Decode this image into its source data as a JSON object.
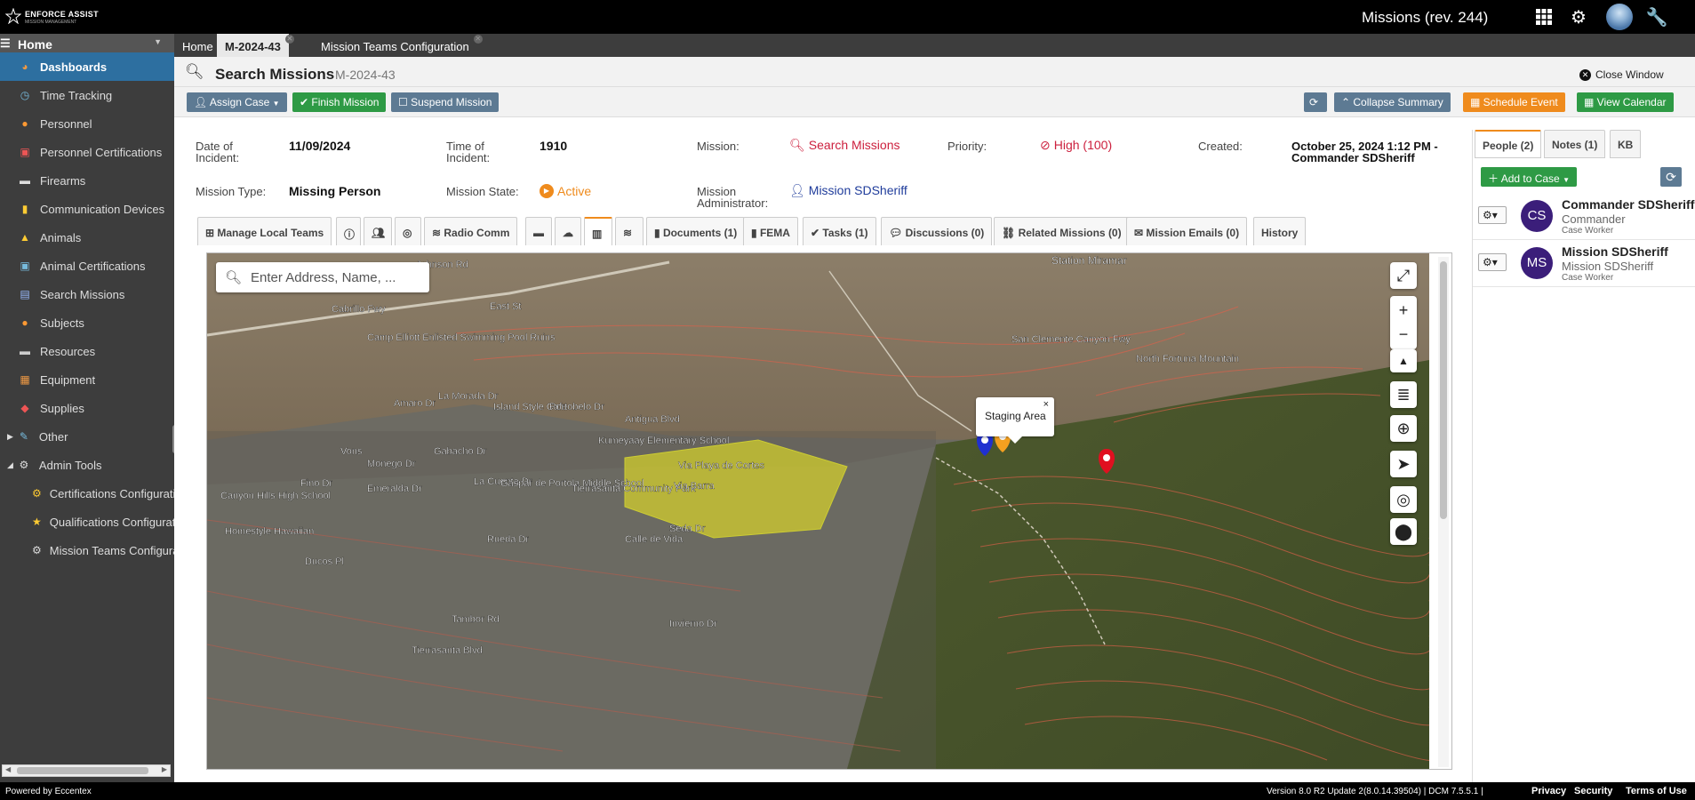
{
  "topbar": {
    "logo_name": "ENFORCE ASSIST",
    "logo_tag": "MISSION MANAGEMENT",
    "title": "Missions (rev. 244)",
    "icons": [
      "apps-grid-icon",
      "gear-icon",
      "user-avatar",
      "wrench-icon"
    ]
  },
  "sidebar": {
    "home": "Home",
    "items": [
      {
        "label": "Dashboards",
        "icon": "dashboard-icon",
        "active": true
      },
      {
        "label": "Time Tracking",
        "icon": "clock-icon"
      },
      {
        "label": "Personnel",
        "icon": "person-icon"
      },
      {
        "label": "Personnel Certifications",
        "icon": "certificate-icon"
      },
      {
        "label": "Firearms",
        "icon": "firearm-icon"
      },
      {
        "label": "Communication Devices",
        "icon": "radio-icon"
      },
      {
        "label": "Animals",
        "icon": "animal-icon"
      },
      {
        "label": "Animal Certifications",
        "icon": "certificate-icon"
      },
      {
        "label": "Search Missions",
        "icon": "document-icon"
      },
      {
        "label": "Subjects",
        "icon": "person-icon"
      },
      {
        "label": "Resources",
        "icon": "truck-icon"
      },
      {
        "label": "Equipment",
        "icon": "equipment-icon"
      },
      {
        "label": "Supplies",
        "icon": "supplies-icon"
      },
      {
        "label": "Other",
        "icon": "wrench-icon"
      },
      {
        "label": "Admin Tools",
        "icon": "gear-icon"
      },
      {
        "label": "Certifications Configuratio",
        "icon": "gear-icon",
        "sub": true
      },
      {
        "label": "Qualifications Configuratio",
        "icon": "medal-icon",
        "sub": true
      },
      {
        "label": "Mission Teams Configurat",
        "icon": "gear-icon",
        "sub": true
      }
    ]
  },
  "tabs": [
    {
      "label": "Home"
    },
    {
      "label": "M-2024-43",
      "active": true
    },
    {
      "label": "Mission Teams Configuration"
    }
  ],
  "header": {
    "title": "Search Missions",
    "subtitle": "M-2024-43",
    "close": "Close Window"
  },
  "actions": {
    "assign_case": "Assign Case",
    "finish": "Finish Mission",
    "suspend": "Suspend Mission",
    "collapse": "Collapse Summary",
    "schedule": "Schedule Event",
    "calendar": "View Calendar"
  },
  "summary": {
    "date_label": "Date of Incident:",
    "date_value": "11/09/2024",
    "time_label": "Time of Incident:",
    "time_value": "1910",
    "mission_label": "Mission:",
    "mission_value": "Search Missions",
    "priority_label": "Priority:",
    "priority_value": "High (100)",
    "created_label": "Created:",
    "created_value": "October 25, 2024 1:12 PM - Commander SDSheriff",
    "type_label": "Mission Type:",
    "type_value": "Missing Person",
    "state_label": "Mission State:",
    "state_value": "Active",
    "admin_label": "Mission Administrator:",
    "admin_value": "Mission SDSheriff"
  },
  "subtabs": [
    {
      "label": "Manage Local Teams",
      "icon": "org-chart-icon"
    },
    {
      "label": "",
      "icon": "info-icon"
    },
    {
      "label": "",
      "icon": "group-icon"
    },
    {
      "label": "",
      "icon": "binoculars-icon"
    },
    {
      "label": "Radio Comm",
      "icon": "wifi-icon"
    },
    {
      "label": "",
      "icon": "truck-icon"
    },
    {
      "label": "",
      "icon": "cloud-icon"
    },
    {
      "label": "",
      "icon": "map-icon",
      "active": true
    },
    {
      "label": "",
      "icon": "signal-icon"
    },
    {
      "label": "Documents (1)",
      "icon": "book-icon"
    },
    {
      "label": "FEMA",
      "icon": "book-icon"
    },
    {
      "label": "Tasks (1)",
      "icon": "check-circle-icon"
    },
    {
      "label": "Discussions (0)",
      "icon": "comment-icon"
    },
    {
      "label": "Related Missions (0)",
      "icon": "link-icon"
    },
    {
      "label": "Mission Emails (0)",
      "icon": "envelope-icon"
    },
    {
      "label": "History",
      "icon": ""
    }
  ],
  "map": {
    "search_placeholder": "Enter Address, Name, ...",
    "popup": "Staging Area",
    "labels": [
      "Station Miramar",
      "Johnson Rd",
      "Cabrillo Fwy",
      "East St",
      "Camp Elliott Enlisted Swimming Pool Ruins",
      "San Clemente Canyon Fwy",
      "North Fortuna Mountain",
      "La Morada Dr",
      "Island Style Cafe",
      "Portobelo Dr",
      "Antigua Blvd",
      "Amaro Dr",
      "Kumeyaay Elementary School",
      "Via Playa de Cortes",
      "Gabacho Dr",
      "Monego Dr",
      "Vons",
      "La Cuenta Dr",
      "Gaspar de Portola Middle School",
      "Tierrasanta Community Park",
      "Canyon Hills High School",
      "Emeralda Dr",
      "Fino Dr",
      "Homestyle Hawaiian",
      "Ducos Pl",
      "Rueda Dr",
      "Seda Dr",
      "Calle de Vida",
      "Tambor Rd",
      "Tierrasanta Blvd",
      "Invierno Dr",
      "Via Barra"
    ]
  },
  "people_panel": {
    "tabs": [
      "People (2)",
      "Notes (1)",
      "KB"
    ],
    "add": "Add to Case",
    "people": [
      {
        "initials": "CS",
        "name": "Commander SDSheriff",
        "role": "Commander",
        "type": "Case Worker"
      },
      {
        "initials": "MS",
        "name": "Mission SDSheriff",
        "role": "Mission SDSheriff",
        "type": "Case Worker"
      }
    ]
  },
  "footer": {
    "powered": "Powered by Eccentex",
    "version": "Version  8.0 R2 Update 2(8.0.14.39504) | DCM 7.5.5.1 |",
    "privacy": "Privacy",
    "security": "Security",
    "terms": "Terms of Use"
  },
  "colors": {
    "accent": "#2d6fa0",
    "green": "#2e9a45",
    "orange": "#ef8b1d",
    "priority": "#cc1f3d",
    "link": "#1f3c9b"
  }
}
